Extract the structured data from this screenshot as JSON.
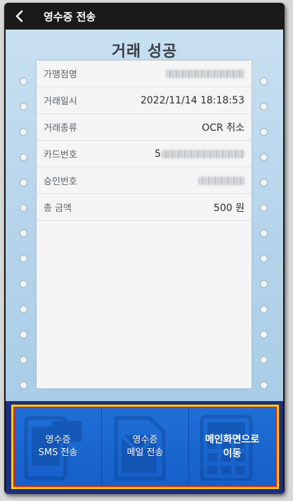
{
  "header": {
    "back_icon": "chevron-left-icon",
    "title": "영수증 전송"
  },
  "main": {
    "result_title": "거래 성공",
    "rows": [
      {
        "label": "가맹점명",
        "value": "",
        "masked": true
      },
      {
        "label": "거래일시",
        "value": "2022/11/14 18:18:53",
        "masked": false
      },
      {
        "label": "거래종류",
        "value": "OCR 취소",
        "masked": false
      },
      {
        "label": "카드번호",
        "value": "5",
        "masked": true
      },
      {
        "label": "승인번호",
        "value": "",
        "masked": true
      },
      {
        "label": "총 금액",
        "value": "500 원",
        "masked": false
      }
    ]
  },
  "buttons": [
    {
      "line1": "영수증",
      "line2": "SMS 전송",
      "icon": "mobile-sms-icon"
    },
    {
      "line1": "영수증",
      "line2": "메일 전송",
      "icon": "document-mail-icon"
    },
    {
      "line1": "메인화면으로",
      "line2": "이동",
      "icon": "keypad-terminal-icon"
    }
  ],
  "colors": {
    "top_bar": "#1a1a1a",
    "screen_background": "#b8d6ec",
    "button_blue": "#1f6fd6",
    "highlight_outer": "#f5d000",
    "highlight_inner": "#e02020"
  }
}
